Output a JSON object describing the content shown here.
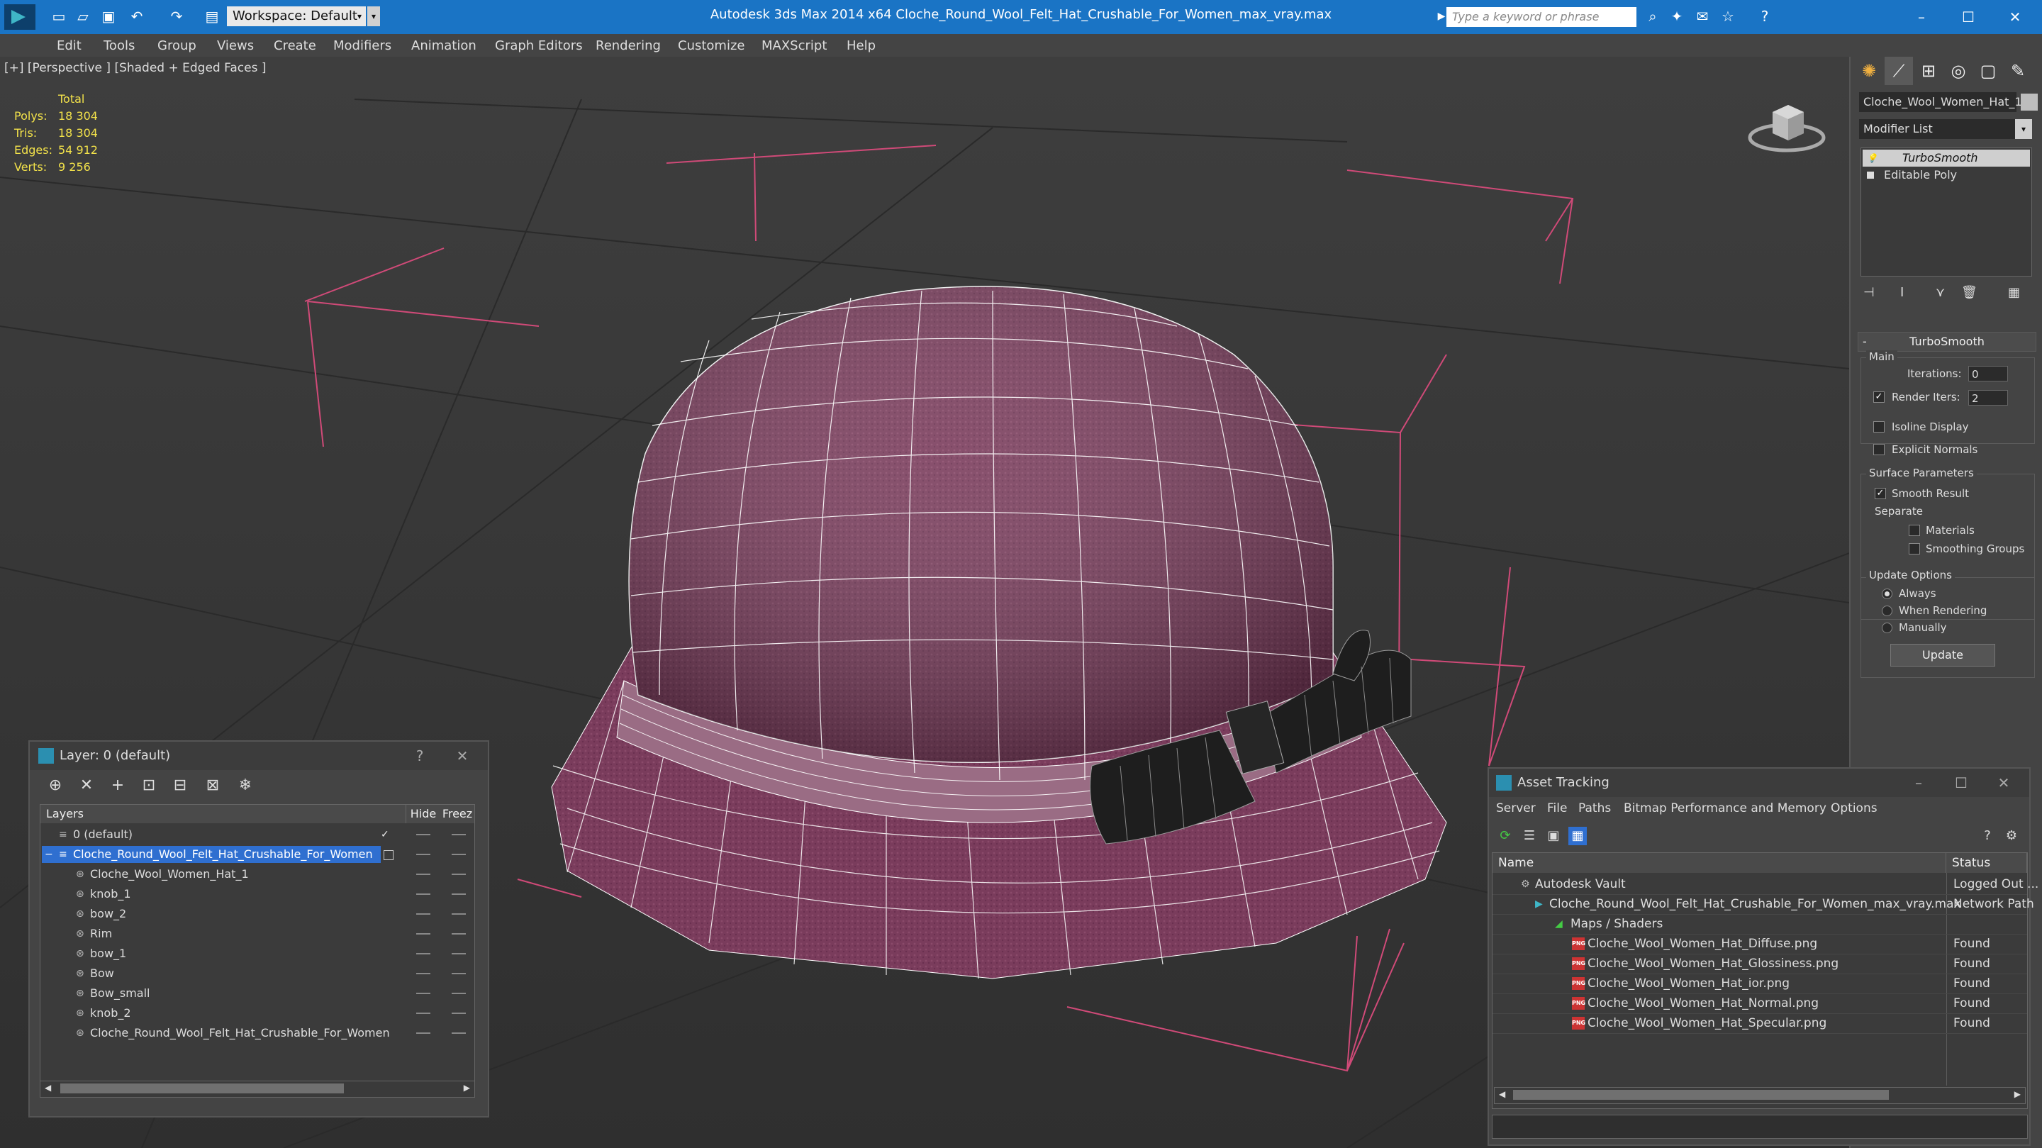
{
  "titlebar": {
    "title": "Autodesk 3ds Max  2014 x64     Cloche_Round_Wool_Felt_Hat_Crushable_For_Women_max_vray.max",
    "workspace": "Workspace: Default",
    "search_placeholder": "Type a keyword or phrase",
    "minimize": "–",
    "maximize": "☐",
    "close": "✕"
  },
  "menu": [
    "Edit",
    "Tools",
    "Group",
    "Views",
    "Create",
    "Modifiers",
    "Animation",
    "Graph Editors",
    "Rendering",
    "Customize",
    "MAXScript",
    "Help"
  ],
  "viewport": {
    "label": "[+] [Perspective ] [Shaded + Edged Faces ]",
    "stats": {
      "total_label": "Total",
      "rows": [
        {
          "label": "Polys:",
          "value": "18 304"
        },
        {
          "label": "Tris:",
          "value": "18 304"
        },
        {
          "label": "Edges:",
          "value": "54 912"
        },
        {
          "label": "Verts:",
          "value": "9 256"
        }
      ]
    }
  },
  "command_panel": {
    "object_name": "Cloche_Wool_Women_Hat_1",
    "modifier_list": "Modifier List",
    "stack": [
      "TurboSmooth",
      "Editable Poly"
    ],
    "turbosmooth": {
      "title": "TurboSmooth",
      "main": "Main",
      "iterations_label": "Iterations:",
      "iterations": "0",
      "render_iters_label": "Render Iters:",
      "render_iters": "2",
      "render_iters_checked": true,
      "isoline": "Isoline Display",
      "explicit": "Explicit Normals",
      "surface_params": "Surface Parameters",
      "smooth_result": "Smooth Result",
      "separate": "Separate",
      "materials": "Materials",
      "smoothing_groups": "Smoothing Groups",
      "update_options": "Update Options",
      "always": "Always",
      "when_rendering": "When Rendering",
      "manually": "Manually",
      "update": "Update"
    }
  },
  "layer_dialog": {
    "title": "Layer: 0 (default)",
    "help": "?",
    "close": "✕",
    "col_layers": "Layers",
    "col_hide": "Hide",
    "col_freeze": "Freez",
    "rows": [
      {
        "name": "0 (default)",
        "indent": 0
      },
      {
        "name": "Cloche_Round_Wool_Felt_Hat_Crushable_For_Women",
        "indent": 0,
        "selected": true
      },
      {
        "name": "Cloche_Wool_Women_Hat_1",
        "indent": 1
      },
      {
        "name": "knob_1",
        "indent": 1
      },
      {
        "name": "bow_2",
        "indent": 1
      },
      {
        "name": "Rim",
        "indent": 1
      },
      {
        "name": "bow_1",
        "indent": 1
      },
      {
        "name": "Bow",
        "indent": 1
      },
      {
        "name": "Bow_small",
        "indent": 1
      },
      {
        "name": "knob_2",
        "indent": 1
      },
      {
        "name": "Cloche_Round_Wool_Felt_Hat_Crushable_For_Women",
        "indent": 1
      }
    ]
  },
  "asset_dialog": {
    "title": "Asset Tracking",
    "menu": [
      "Server",
      "File",
      "Paths",
      "Bitmap Performance and Memory",
      "Options"
    ],
    "col_name": "Name",
    "col_status": "Status",
    "rows": [
      {
        "name": "Autodesk Vault",
        "status": "Logged Out ...",
        "indent": 1,
        "icon": "vault"
      },
      {
        "name": "Cloche_Round_Wool_Felt_Hat_Crushable_For_Women_max_vray.max",
        "status": "Network Path",
        "indent": 2,
        "icon": "max"
      },
      {
        "name": "Maps / Shaders",
        "status": "",
        "indent": 3,
        "icon": "maps"
      },
      {
        "name": "Cloche_Wool_Women_Hat_Diffuse.png",
        "status": "Found",
        "indent": 4,
        "icon": "png"
      },
      {
        "name": "Cloche_Wool_Women_Hat_Glossiness.png",
        "status": "Found",
        "indent": 4,
        "icon": "png"
      },
      {
        "name": "Cloche_Wool_Women_Hat_ior.png",
        "status": "Found",
        "indent": 4,
        "icon": "png"
      },
      {
        "name": "Cloche_Wool_Women_Hat_Normal.png",
        "status": "Found",
        "indent": 4,
        "icon": "png"
      },
      {
        "name": "Cloche_Wool_Women_Hat_Specular.png",
        "status": "Found",
        "indent": 4,
        "icon": "png"
      }
    ],
    "png_badge": "PNG"
  }
}
